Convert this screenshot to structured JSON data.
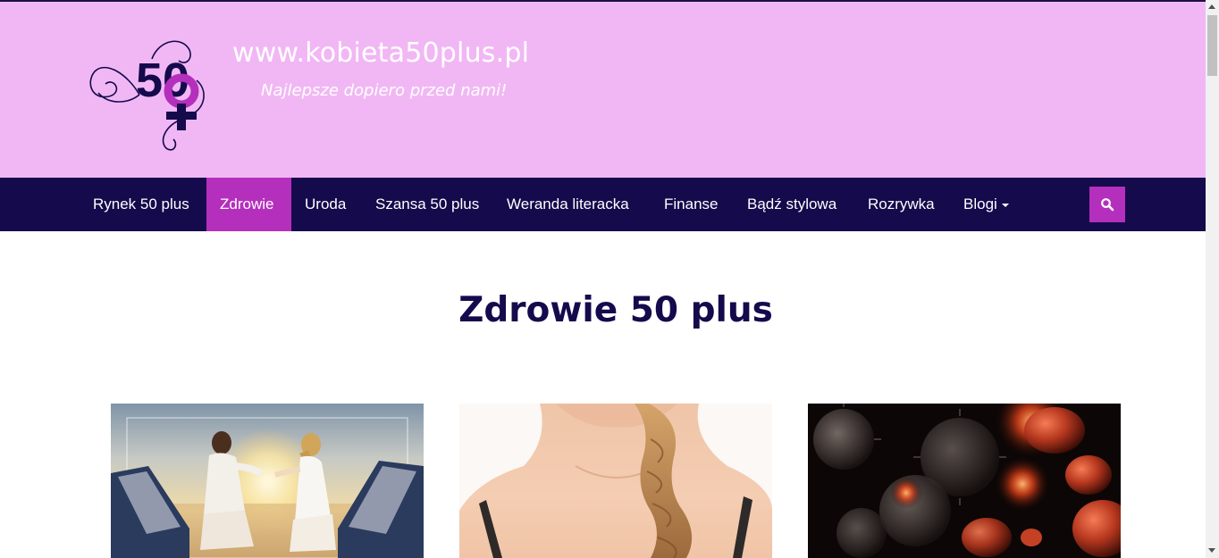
{
  "site": {
    "title": "www.kobieta50plus.pl",
    "tagline": "Najlepsze dopiero przed nami!",
    "logo_text": "50"
  },
  "nav": {
    "items": [
      {
        "label": "Rynek 50 plus",
        "active": false
      },
      {
        "label": "Zdrowie",
        "active": true
      },
      {
        "label": "Uroda",
        "active": false
      },
      {
        "label": "Szansa 50 plus",
        "active": false
      },
      {
        "label": "Weranda literacka",
        "active": false
      },
      {
        "label": "Finanse",
        "active": false
      },
      {
        "label": "Bądź stylowa",
        "active": false
      },
      {
        "label": "Rozrywka",
        "active": false
      },
      {
        "label": "Blogi",
        "active": false,
        "dropdown": true
      }
    ],
    "search_icon": "search-icon"
  },
  "main": {
    "title": "Zdrowie 50 plus"
  },
  "colors": {
    "header_bg": "#f1b7f4",
    "nav_bg": "#140a4c",
    "accent": "#b52fbd",
    "title_color": "#140a4c"
  }
}
